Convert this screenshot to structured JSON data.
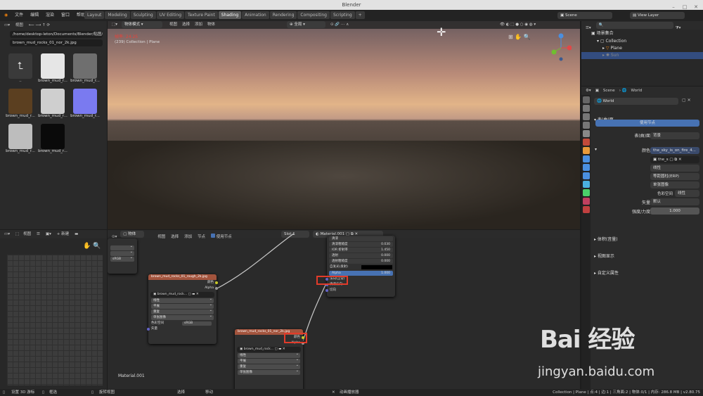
{
  "window_title": "Blender",
  "top_menu": [
    "文件",
    "编辑",
    "渲染",
    "窗口",
    "帮助"
  ],
  "workspaces": [
    "Layout",
    "Modeling",
    "Sculpting",
    "UV Editing",
    "Texture Paint",
    "Shading",
    "Animation",
    "Rendering",
    "Compositing",
    "Scripting"
  ],
  "active_workspace": "Shading",
  "scene": {
    "name": "Scene",
    "view_layer": "View Layer"
  },
  "file_browser": {
    "path": "/home/desktop-leton/Documents/Blender/贴图/...",
    "filename": "brown_mud_rocks_01_nor_2k.jpg",
    "parent_label": "..",
    "items": [
      {
        "caption": "brown_mud_r...",
        "color": "#e6e6e6"
      },
      {
        "caption": "brown_mud_r...",
        "color": "#6f6f6f"
      },
      {
        "caption": "brown_mud_r...",
        "color": "#5b3f20"
      },
      {
        "caption": "brown_mud_r...",
        "color": "#cfcfcf"
      },
      {
        "caption": "brown_mud_r...",
        "color": "#7a7af0"
      },
      {
        "caption": "brown_mud_r...",
        "color": "#bdbdbd"
      },
      {
        "caption": "brown_mud_r...",
        "color": "#0a0a0a"
      }
    ]
  },
  "viewport": {
    "mode": "物体模式",
    "menus": [
      "视图",
      "选择",
      "添加",
      "物体"
    ],
    "transform": "全局",
    "fps": "帧率: 24.25",
    "info": "(239) Collection | Plane"
  },
  "outliner": {
    "title": "场景集合",
    "items": [
      "Collection",
      "Plane",
      "Sun"
    ]
  },
  "properties": {
    "breadcrumb_scene": "Scene",
    "breadcrumb_world": "World",
    "world_name": "World",
    "section_surface": "表(曲)面",
    "use_nodes": "使用节点",
    "surface_label": "表(曲)面",
    "surface_value": "背景",
    "color_label": "颜色",
    "color_value": "the_sky_is_on_fire_4...",
    "image_name": "the_s",
    "interp": "线性",
    "projection": "等距圆柱(ERP)",
    "source": "单张图像",
    "colorspace_label": "色彩空间",
    "colorspace_value": "线性",
    "vector_label": "矢量",
    "vector_value": "默认",
    "strength_label": "强度/力度",
    "strength_value": "1.000",
    "volume": "体积(音量)",
    "viewport_display": "视图显示",
    "custom_props": "自定义属性"
  },
  "image_editor": {
    "view_menu": "视图",
    "new_button": "新建"
  },
  "node_editor": {
    "object_menu": "物体",
    "menus": [
      "视图",
      "选择",
      "添加",
      "节点"
    ],
    "use_nodes": "使用节点",
    "slot": "Slot 1",
    "material": "Material.001",
    "footer_material": "Material.001",
    "partial_node_label": "sRGB",
    "bsdf_rows": [
      {
        "label": "清漆",
        "value": ""
      },
      {
        "label": "清漆粗糙度",
        "value": "0.030"
      },
      {
        "label": "IOR 折射率",
        "value": "1.450"
      },
      {
        "label": "透射",
        "value": "0.000"
      },
      {
        "label": "透射粗糙度",
        "value": "0.000"
      },
      {
        "label": "自发光(发射)",
        "value": ""
      },
      {
        "label": "Alpha",
        "value": "1.000"
      }
    ],
    "bsdf_inputs": [
      "法向(正常)",
      "清漆法向",
      "切向"
    ],
    "rough_node": {
      "title": "brown_mud_rocks_01_rough_2k.jpg",
      "out_color": "颜色",
      "out_alpha": "Alpha",
      "image": "brown_mud_rock...",
      "interp": "线性",
      "proj": "平展",
      "ext": "重复",
      "source": "单张图像",
      "cs_label": "色彩空间",
      "cs_value": "sRGB",
      "vector": "矢量"
    },
    "nor_node": {
      "title": "brown_mud_rocks_01_nor_2k.jpg",
      "out_color": "颜色",
      "out_alpha": "Alpha",
      "image": "brown_mud_rock...",
      "interp": "线性",
      "proj": "平展",
      "ext": "重复",
      "source": "单张图像"
    }
  },
  "status_bar": {
    "left1": "设置 3D 游标",
    "left2": "框选",
    "left3": "旋转视图",
    "mid1": "选择",
    "mid2": "移动",
    "mid3": "动画播放器",
    "right": "Collection | Plane | 点:4 | 边:1 | 三角面:2 | 物体:0/1 | 内存: 286.8 MB | v2.80.75"
  },
  "watermark": {
    "brand": "Bai 经验",
    "url": "jingyan.baidu.com"
  },
  "colors": {
    "accent": "#4772b3",
    "highlight": "#e23b2a",
    "node_header": "#a3543d"
  }
}
